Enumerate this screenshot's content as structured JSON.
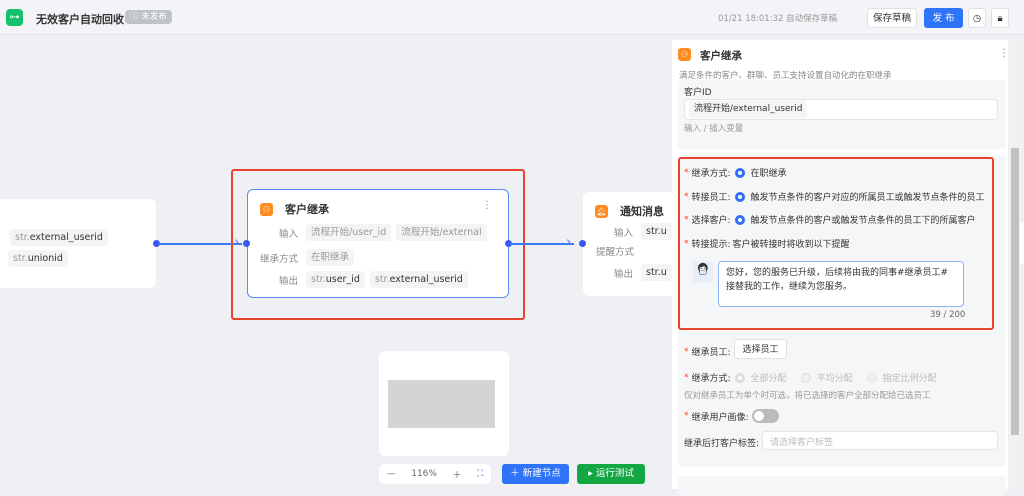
{
  "header": {
    "title": "无效客户自动回收",
    "status": "未发布",
    "autosave": "01/21 18:01:32 自动保存草稿",
    "save_draft": "保存草稿",
    "publish": "发 布"
  },
  "nodes": {
    "left": {
      "tags": [
        "external_userid",
        "unionid"
      ],
      "prefix": "str."
    },
    "main": {
      "title": "客户继承",
      "input_label": "输入",
      "inputs": [
        "流程开始/user_id",
        "流程开始/external"
      ],
      "mode_label": "继承方式",
      "mode": "在职继承",
      "output_label": "输出",
      "outputs": [
        "user_id",
        "external_userid"
      ],
      "prefix": "str."
    },
    "notify": {
      "title": "通知消息",
      "input_label": "输入",
      "remind_label": "提醒方式",
      "output_label": "输出",
      "tag": "str.u"
    }
  },
  "minimap": {
    "zoom": "116%"
  },
  "bottom": {
    "new_node": "新建节点",
    "run_test": "运行测试"
  },
  "panel": {
    "title": "客户继承",
    "desc": "满足条件的客户、群聊、员工支持设置自动化的在职继承",
    "customer_id_label": "客户ID",
    "customer_id_value": "流程开始/external_userid",
    "customer_id_hint": "输入 / 插入变量",
    "inherit_mode_label": "继承方式:",
    "inherit_mode": "在职继承",
    "transfer_staff_label": "转接员工:",
    "transfer_staff": "触发节点条件的客户对应的所属员工或触发节点条件的员工",
    "select_customer_label": "选择客户:",
    "select_customer": "触发节点条件的客户或触发节点条件的员工下的所属客户",
    "tip_label": "转接提示:",
    "tip": "客户被转接时将收到以下提醒",
    "message": "您好，您的服务已升级，后续将由我的同事#继承员工#接替我的工作，继续为您服务。",
    "count": "39 / 200",
    "heir_label": "继承员工:",
    "heir_button": "选择员工",
    "dist_label": "继承方式:",
    "dist_options": [
      "全部分配",
      "平均分配",
      "指定比例分配"
    ],
    "dist_hint": "仅对继承员工为单个时可选，将已选择的客户全部分配给已选员工",
    "portrait_label": "继承用户画像:",
    "portrait_on": false,
    "tag_label": "继承后打客户标签:",
    "tag_placeholder": "请选择客户标签"
  }
}
